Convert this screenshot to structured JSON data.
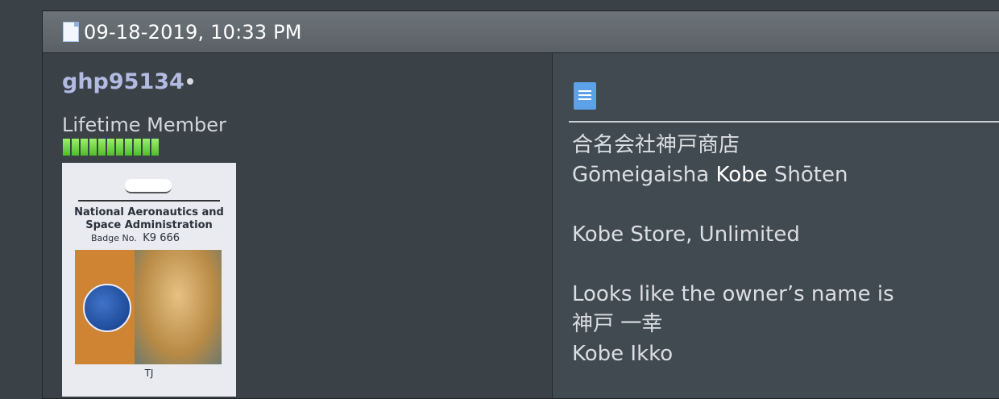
{
  "post": {
    "date": "09-18-2019, 10:33 PM"
  },
  "user": {
    "name": "ghp95134",
    "title": "Lifetime Member",
    "reputation_pips": 11,
    "avatar": {
      "line1": "National Aeronautics and",
      "line2": "Space Administration",
      "badge_label": "Badge No.",
      "badge_value": "K9  666",
      "name": "TJ"
    }
  },
  "message": {
    "line1": "合名会社神戸商店",
    "line2_pre": "Gōmeigaisha ",
    "line2_highlight": "Kobe",
    "line2_post": " Shōten",
    "line4": "Kobe Store, Unlimited",
    "line6": "Looks like the owner’s name is",
    "line7": "神戸 一幸",
    "line8": "Kobe Ikko"
  },
  "colors": {
    "username": "#b4bbe3",
    "reputation": "#5ed436"
  }
}
